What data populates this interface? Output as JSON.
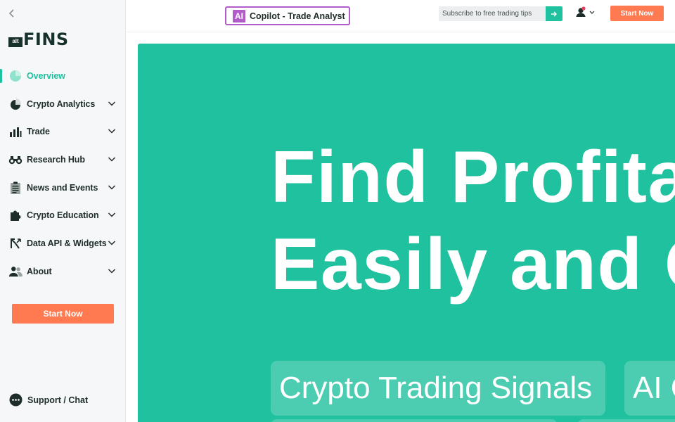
{
  "brand": {
    "logo_small": "alt",
    "logo_text": "FINS"
  },
  "sidebar": {
    "items": [
      {
        "label": "Overview",
        "icon": "overview-icon",
        "active": true,
        "expandable": false
      },
      {
        "label": "Crypto Analytics",
        "icon": "pie-chart-icon",
        "active": false,
        "expandable": true
      },
      {
        "label": "Trade",
        "icon": "bar-chart-icon",
        "active": false,
        "expandable": true
      },
      {
        "label": "Research Hub",
        "icon": "binoculars-icon",
        "active": false,
        "expandable": true
      },
      {
        "label": "News and Events",
        "icon": "clipboard-icon",
        "active": false,
        "expandable": true
      },
      {
        "label": "Crypto Education",
        "icon": "puzzle-icon",
        "active": false,
        "expandable": true
      },
      {
        "label": "Data API & Widgets",
        "icon": "api-arrows-icon",
        "active": false,
        "expandable": true
      },
      {
        "label": "About",
        "icon": "users-icon",
        "active": false,
        "expandable": true
      }
    ],
    "start_label": "Start Now",
    "support_label": "Support / Chat"
  },
  "header": {
    "copilot_badge": "AI",
    "copilot_label": "Copilot - Trade Analyst",
    "subscribe_placeholder": "Subscribe to free trading tips",
    "start_label": "Start Now"
  },
  "hero": {
    "headline": "Find Profitab\nEasily and Q",
    "chips": [
      "Crypto Trading Signals",
      "AI C"
    ]
  },
  "colors": {
    "accent": "#20c19e",
    "cta": "#ff7a50",
    "copilot": "#b25cc9",
    "brand_dark": "#17322c"
  }
}
